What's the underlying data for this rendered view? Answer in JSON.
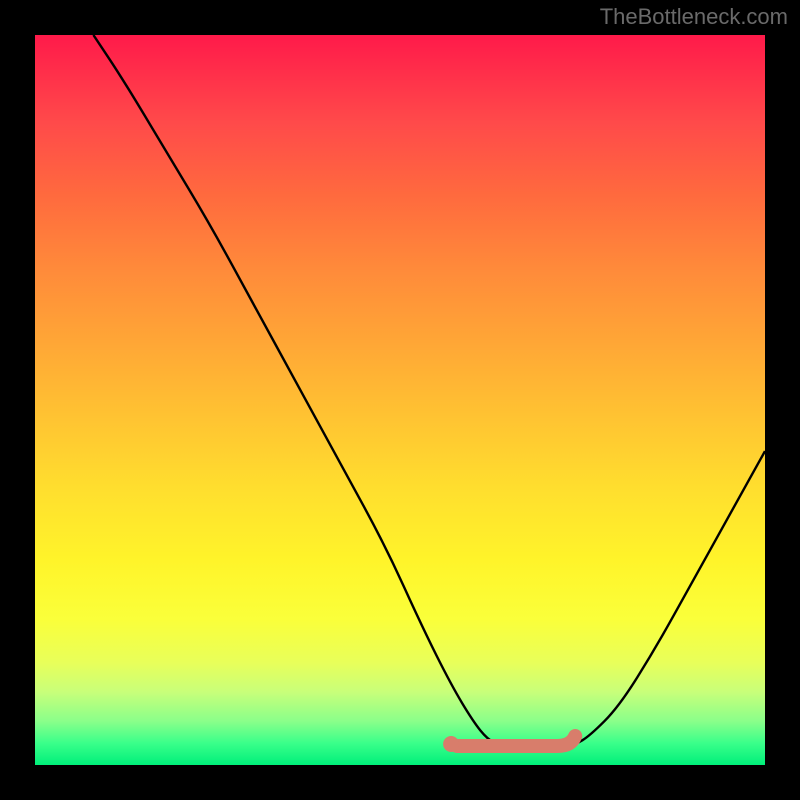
{
  "watermark": "TheBottleneck.com",
  "chart_data": {
    "type": "line",
    "title": "",
    "xlabel": "",
    "ylabel": "",
    "xlim": [
      0,
      100
    ],
    "ylim": [
      0,
      100
    ],
    "series": [
      {
        "name": "curve",
        "x": [
          8,
          12,
          18,
          24,
          30,
          36,
          42,
          48,
          53,
          57,
          60,
          62,
          64,
          68,
          72,
          74,
          76,
          80,
          85,
          90,
          95,
          100
        ],
        "y": [
          100,
          94,
          84,
          74,
          63,
          52,
          41,
          30,
          19,
          11,
          6,
          3.5,
          2.5,
          2.2,
          2.3,
          2.8,
          4,
          8,
          16,
          25,
          34,
          43
        ]
      }
    ],
    "marker_zone": {
      "x_start": 57,
      "x_end": 74,
      "y": 2.6,
      "color": "#d87d6b"
    },
    "gradient_stops": [
      {
        "pos": 0,
        "color": "#ff1a4a"
      },
      {
        "pos": 12,
        "color": "#ff4a4a"
      },
      {
        "pos": 32,
        "color": "#ff8a3a"
      },
      {
        "pos": 62,
        "color": "#ffde2e"
      },
      {
        "pos": 86,
        "color": "#e8ff5a"
      },
      {
        "pos": 100,
        "color": "#00ef7a"
      }
    ]
  }
}
